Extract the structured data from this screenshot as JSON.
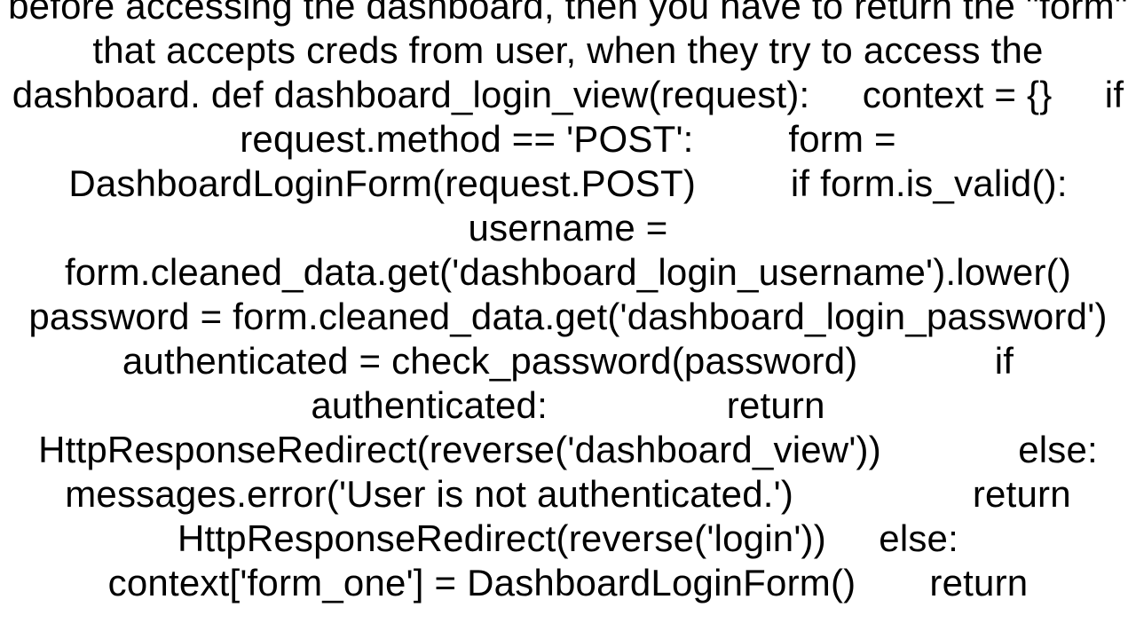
{
  "text": "before accessing the dashboard, then you have to return the \"form\" that accepts creds from user, when they try to access the dashboard. def dashboard_login_view(request):     context = {}     if request.method == 'POST':         form = DashboardLoginForm(request.POST)         if form.is_valid():             username = form.cleaned_data.get('dashboard_login_username').lower()             password = form.cleaned_data.get('dashboard_login_password')             authenticated = check_password(password)             if authenticated:                 return HttpResponseRedirect(reverse('dashboard_view'))             else:                 messages.error('User is not authenticated.')                 return HttpResponseRedirect(reverse('login'))     else:         context['form_one'] = DashboardLoginForm()       return"
}
